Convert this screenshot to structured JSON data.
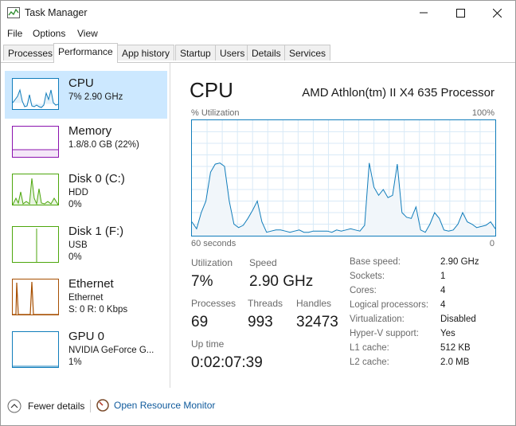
{
  "window": {
    "title": "Task Manager"
  },
  "menu": [
    "File",
    "Options",
    "View"
  ],
  "tabs": [
    "Processes",
    "Performance",
    "App history",
    "Startup",
    "Users",
    "Details",
    "Services"
  ],
  "sidebar": [
    {
      "name": "CPU",
      "line1": "7% 2.90 GHz",
      "line2": "",
      "color": "#117dbb"
    },
    {
      "name": "Memory",
      "line1": "1.8/8.0 GB (22%)",
      "line2": "",
      "color": "#8b12ae"
    },
    {
      "name": "Disk 0 (C:)",
      "line1": "HDD",
      "line2": "0%",
      "color": "#4da60c"
    },
    {
      "name": "Disk 1 (F:)",
      "line1": "USB",
      "line2": "0%",
      "color": "#4da60c"
    },
    {
      "name": "Ethernet",
      "line1": "Ethernet",
      "line2": "S: 0  R: 0 Kbps",
      "color": "#a74f01"
    },
    {
      "name": "GPU 0",
      "line1": "NVIDIA GeForce G...",
      "line2": "1%",
      "color": "#117dbb"
    }
  ],
  "main": {
    "title": "CPU",
    "processor": "AMD Athlon(tm) II X4 635 Processor",
    "graph_label": "% Utilization",
    "graph_max": "100%",
    "graph_time": "60 seconds",
    "graph_min": "0",
    "graph_values": [
      12,
      6,
      20,
      30,
      55,
      62,
      63,
      60,
      30,
      10,
      7,
      9,
      15,
      22,
      30,
      12,
      3,
      4,
      5,
      5,
      4,
      3,
      4,
      5,
      3,
      3,
      4,
      4,
      4,
      4,
      3,
      5,
      4,
      5,
      6,
      5,
      4,
      9,
      63,
      42,
      35,
      40,
      33,
      35,
      62,
      20,
      16,
      15,
      25,
      5,
      3,
      10,
      20,
      15,
      5,
      4,
      5,
      10,
      20,
      12,
      10,
      7,
      8,
      9,
      12,
      6
    ],
    "stats": {
      "utilization_label": "Utilization",
      "utilization": "7%",
      "speed_label": "Speed",
      "speed": "2.90 GHz",
      "processes_label": "Processes",
      "processes": "69",
      "threads_label": "Threads",
      "threads": "993",
      "handles_label": "Handles",
      "handles": "32473",
      "uptime_label": "Up time",
      "uptime": "0:02:07:39"
    },
    "specs": [
      {
        "label": "Base speed:",
        "value": "2.90 GHz"
      },
      {
        "label": "Sockets:",
        "value": "1"
      },
      {
        "label": "Cores:",
        "value": "4"
      },
      {
        "label": "Logical processors:",
        "value": "4"
      },
      {
        "label": "Virtualization:",
        "value": "Disabled"
      },
      {
        "label": "Hyper-V support:",
        "value": "Yes"
      },
      {
        "label": "L1 cache:",
        "value": "512 KB"
      },
      {
        "label": "L2 cache:",
        "value": "2.0 MB"
      }
    ]
  },
  "footer": {
    "fewer_details": "Fewer details",
    "open_monitor": "Open Resource Monitor"
  }
}
